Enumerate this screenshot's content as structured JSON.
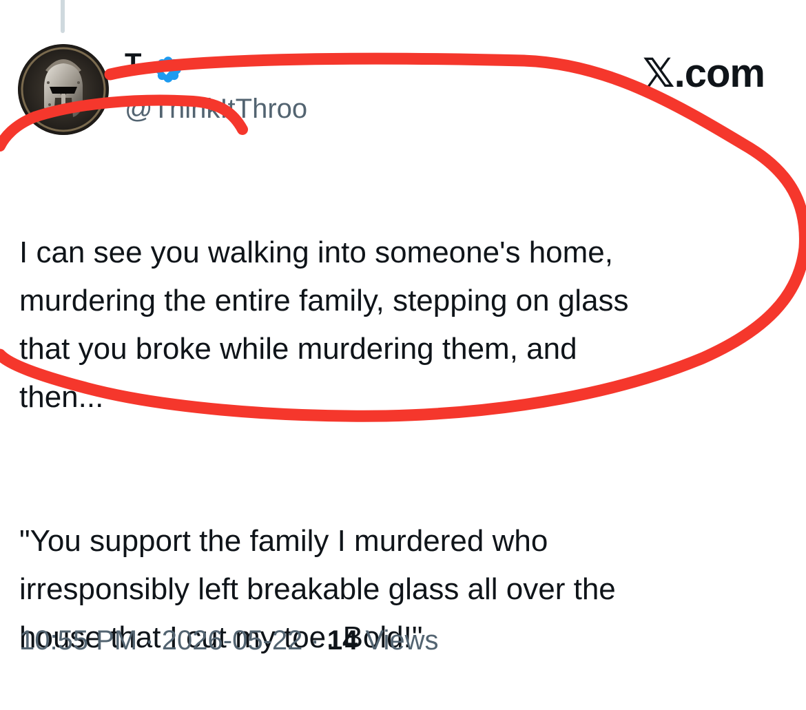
{
  "tweet": {
    "author": {
      "display_name": "T",
      "handle": "@ThinkItThroo",
      "verified": true,
      "avatar_icon": "spartan-helmet-avatar"
    },
    "brand": "𝕏.com",
    "paragraphs": [
      "I can see you walking into someone's home,\nmurdering the entire family, stepping on glass\nthat you broke while murdering them, and\nthen...",
      "\"You support the family I murdered who\nirresponsibly left breakable glass all over the\nhouse that I cut my toe. Bold!\""
    ],
    "meta": {
      "time": "10:55 PM",
      "separator": " · ",
      "date": "2026-05-22",
      "views_count": "14",
      "views_label": "Views"
    }
  },
  "annotation": {
    "type": "red-freehand-circle",
    "color": "#f5372c"
  },
  "colors": {
    "text": "#0f1419",
    "secondary": "#536471",
    "verified": "#1d9bf0",
    "thread_line": "#cfd9de"
  }
}
